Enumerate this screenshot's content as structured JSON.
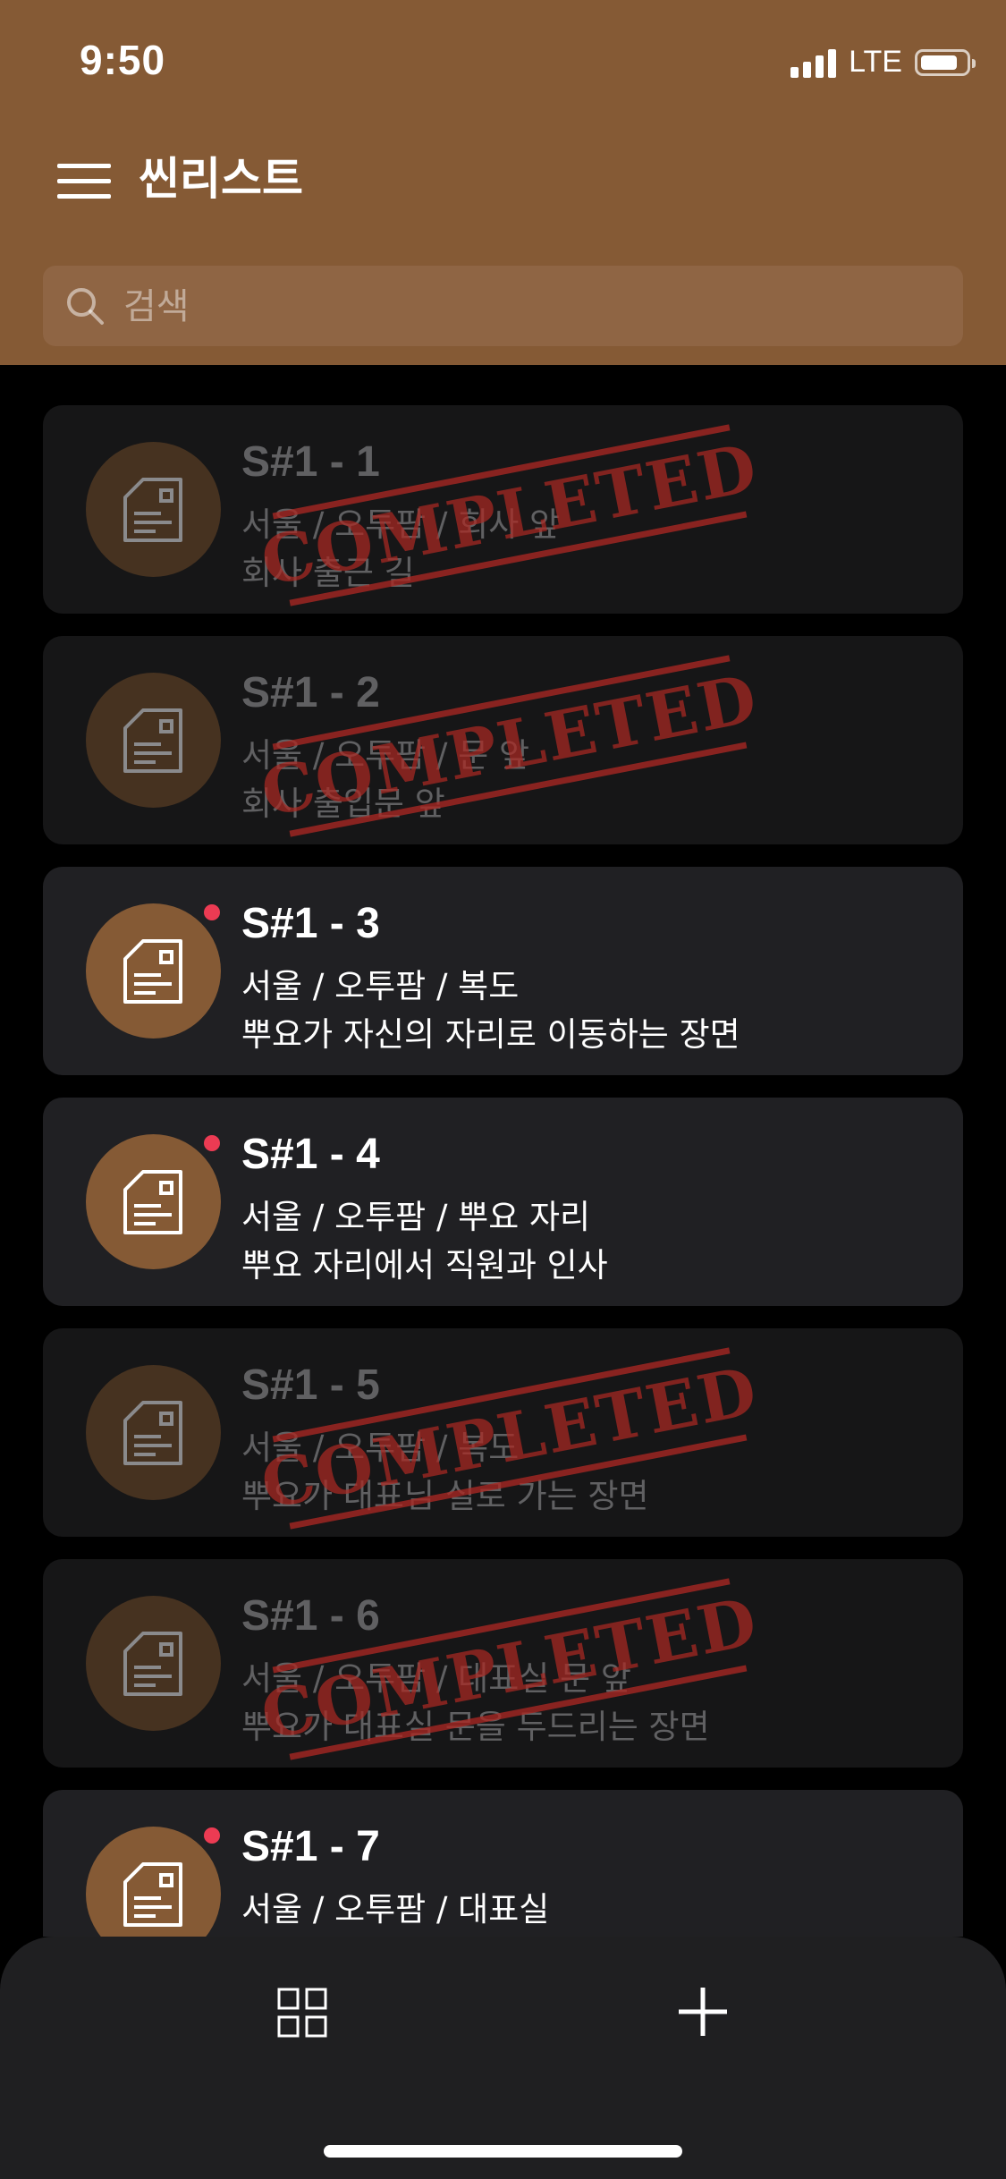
{
  "status_bar": {
    "time": "9:50",
    "network": "LTE"
  },
  "header": {
    "title": "씬리스트"
  },
  "search": {
    "placeholder": "검색"
  },
  "stamp_text": "COMPLETED",
  "scenes": [
    {
      "number": "S#1 - 1",
      "location": "서울 / 오투팜 / 회사 앞",
      "description": "회사 출근 길",
      "completed": true,
      "unread": false
    },
    {
      "number": "S#1 - 2",
      "location": "서울 / 오투팜 / 문 앞",
      "description": "회사 출입문 앞",
      "completed": true,
      "unread": false
    },
    {
      "number": "S#1 - 3",
      "location": "서울 / 오투팜 / 복도",
      "description": "뿌요가 자신의 자리로 이동하는 장면",
      "completed": false,
      "unread": true
    },
    {
      "number": "S#1 - 4",
      "location": "서울 / 오투팜 / 뿌요 자리",
      "description": "뿌요 자리에서 직원과 인사",
      "completed": false,
      "unread": true
    },
    {
      "number": "S#1 - 5",
      "location": "서울 / 오투팜 / 복도",
      "description": "뿌요가 대표님 실로 가는 장면",
      "completed": true,
      "unread": false
    },
    {
      "number": "S#1 - 6",
      "location": "서울 / 오투팜 / 대표실 문 앞",
      "description": "뿌요가 대표실 문을 두드리는 장면",
      "completed": true,
      "unread": false
    },
    {
      "number": "S#1 - 7",
      "location": "서울 / 오투팜 / 대표실",
      "description": "",
      "completed": false,
      "unread": true
    }
  ],
  "colors": {
    "header": "#855a35",
    "accent_dot": "#ec3b53",
    "stamp": "#aa2823"
  }
}
